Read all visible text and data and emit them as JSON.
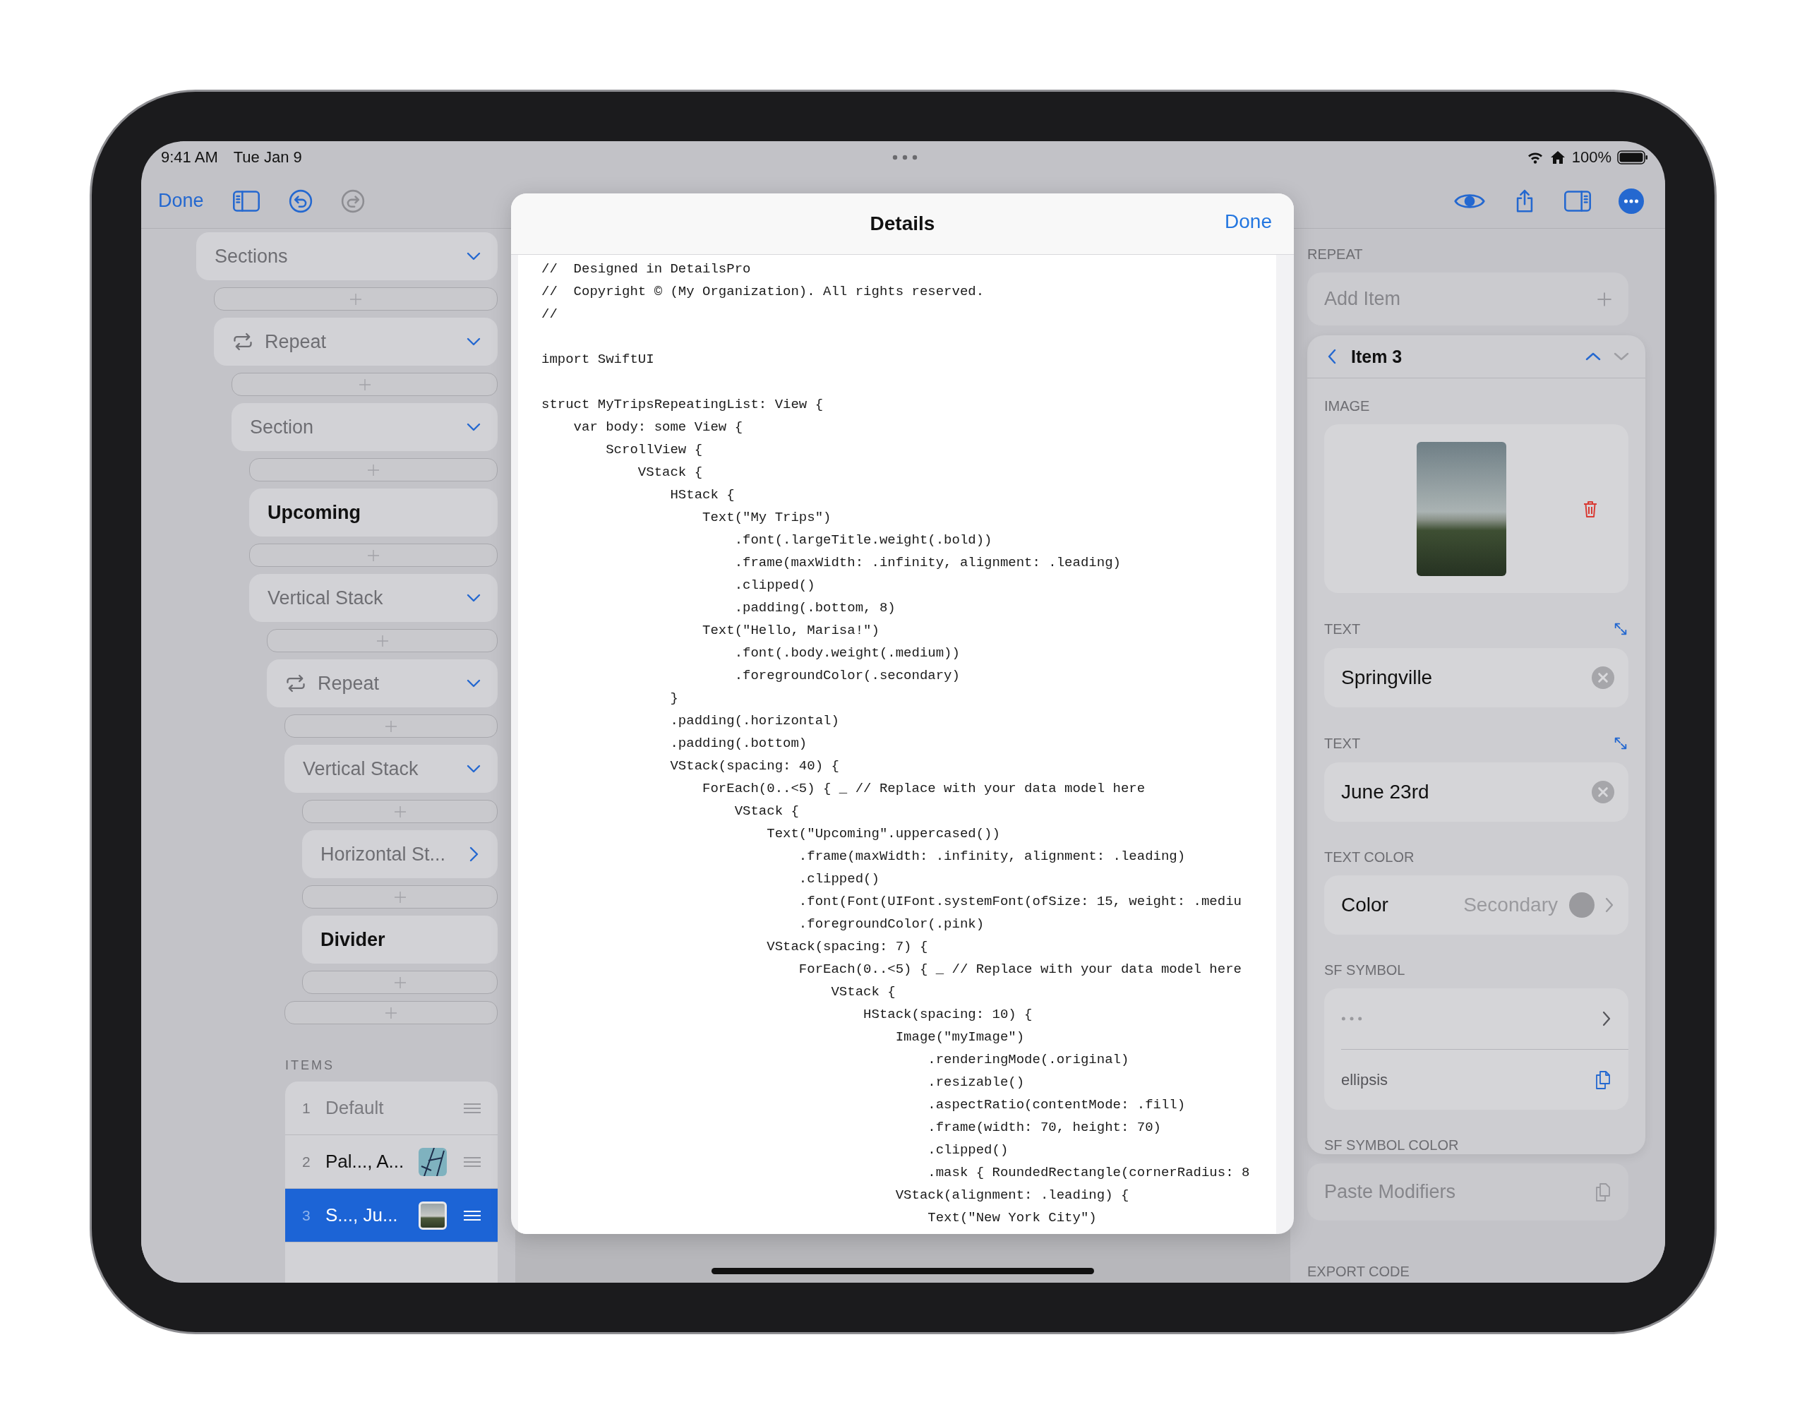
{
  "status_bar": {
    "time": "9:41 AM",
    "date": "Tue Jan 9",
    "battery": "100%"
  },
  "toolbar": {
    "done": "Done",
    "undo_enabled": true,
    "redo_enabled": false
  },
  "sidebar": {
    "tree": [
      {
        "kind": "group",
        "label": "Sections",
        "expanded": true,
        "children": [
          {
            "kind": "add"
          },
          {
            "kind": "repeat",
            "label": "Repeat",
            "expanded": true,
            "children": [
              {
                "kind": "add"
              },
              {
                "kind": "group",
                "label": "Section",
                "expanded": true,
                "children": [
                  {
                    "kind": "add"
                  },
                  {
                    "kind": "leaf",
                    "label": "Upcoming"
                  },
                  {
                    "kind": "add"
                  },
                  {
                    "kind": "group",
                    "label": "Vertical Stack",
                    "expanded": true,
                    "children": [
                      {
                        "kind": "add"
                      },
                      {
                        "kind": "repeat",
                        "label": "Repeat",
                        "expanded": true,
                        "children": [
                          {
                            "kind": "add"
                          },
                          {
                            "kind": "group",
                            "label": "Vertical Stack",
                            "expanded": true,
                            "children": [
                              {
                                "kind": "add"
                              },
                              {
                                "kind": "group",
                                "label": "Horizontal St...",
                                "expanded": false
                              },
                              {
                                "kind": "add"
                              },
                              {
                                "kind": "leaf",
                                "label": "Divider"
                              },
                              {
                                "kind": "add"
                              }
                            ]
                          },
                          {
                            "kind": "add"
                          }
                        ]
                      }
                    ]
                  }
                ]
              }
            ]
          }
        ]
      }
    ],
    "items_header": "ITEMS",
    "items": [
      {
        "kind": "plain",
        "number": "1",
        "label": "Default",
        "muted": true,
        "selected": false
      },
      {
        "kind": "map",
        "number": "2",
        "label": "Pal..., A...",
        "muted": false,
        "selected": false
      },
      {
        "kind": "photo",
        "number": "3",
        "label": "S..., Ju...",
        "muted": false,
        "selected": true
      }
    ]
  },
  "modal": {
    "title": "Details",
    "done": "Done",
    "code": "//  Designed in DetailsPro\n//  Copyright © (My Organization). All rights reserved.\n//\n\nimport SwiftUI\n\nstruct MyTripsRepeatingList: View {\n    var body: some View {\n        ScrollView {\n            VStack {\n                HStack {\n                    Text(\"My Trips\")\n                        .font(.largeTitle.weight(.bold))\n                        .frame(maxWidth: .infinity, alignment: .leading)\n                        .clipped()\n                        .padding(.bottom, 8)\n                    Text(\"Hello, Marisa!\")\n                        .font(.body.weight(.medium))\n                        .foregroundColor(.secondary)\n                }\n                .padding(.horizontal)\n                .padding(.bottom)\n                VStack(spacing: 40) {\n                    ForEach(0..<5) { _ // Replace with your data model here\n                        VStack {\n                            Text(\"Upcoming\".uppercased())\n                                .frame(maxWidth: .infinity, alignment: .leading)\n                                .clipped()\n                                .font(Font(UIFont.systemFont(ofSize: 15, weight: .mediu\n                                .foregroundColor(.pink)\n                            VStack(spacing: 7) {\n                                ForEach(0..<5) { _ // Replace with your data model here\n                                    VStack {\n                                        HStack(spacing: 10) {\n                                            Image(\"myImage\")\n                                                .renderingMode(.original)\n                                                .resizable()\n                                                .aspectRatio(contentMode: .fill)\n                                                .frame(width: 70, height: 70)\n                                                .clipped()\n                                                .mask { RoundedRectangle(cornerRadius: 8\n                                            VStack(alignment: .leading) {\n                                                Text(\"New York City\")"
  },
  "inspector": {
    "header": "REPEAT",
    "add_field": {
      "placeholder": "Add Item",
      "disabled": true
    },
    "item_card": {
      "title": "Item 3",
      "up_enabled": true,
      "down_enabled": false,
      "sections": [
        {
          "kind": "image",
          "label": "IMAGE"
        },
        {
          "kind": "text",
          "label": "TEXT",
          "value": "Springville"
        },
        {
          "kind": "text",
          "label": "TEXT",
          "value": "June 23rd"
        },
        {
          "kind": "color",
          "label": "TEXT COLOR",
          "name": "Color",
          "value": "Secondary",
          "color": "#9a9a9e"
        },
        {
          "kind": "symbol",
          "label": "SF SYMBOL",
          "symbol_name": "ellipsis"
        },
        {
          "kind": "heading",
          "label": "SF SYMBOL COLOR"
        }
      ]
    },
    "paste": {
      "label": "Paste Modifiers",
      "disabled": true
    },
    "footer": "EXPORT CODE"
  }
}
